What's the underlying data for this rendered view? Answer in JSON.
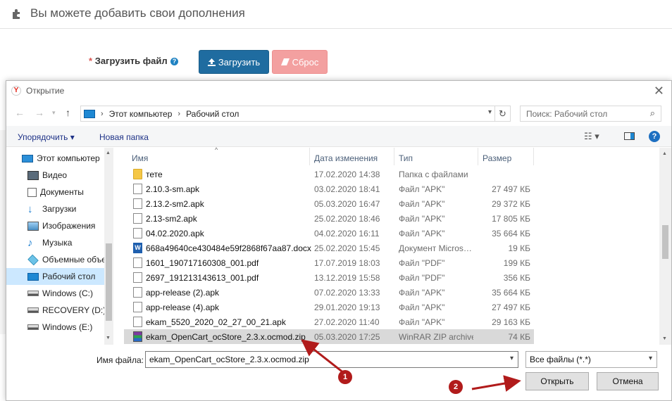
{
  "page": {
    "header_title": "Вы можете добавить свои дополнения",
    "required_star": "*",
    "upload_label": "Загрузить файл",
    "upload_button": "Загрузить",
    "reset_button": "Сброс",
    "help_glyph": "?"
  },
  "dialog": {
    "title": "Открытие",
    "address": {
      "crumbs": [
        "Этот компьютер",
        "Рабочий стол"
      ],
      "separator": "›"
    },
    "search_placeholder": "Поиск: Рабочий стол",
    "toolbar": {
      "organize": "Упорядочить ▾",
      "new_folder": "Новая папка",
      "help_glyph": "?"
    },
    "nav": [
      {
        "label": "Этот компьютер",
        "icon": "computer-icon"
      },
      {
        "label": "Видео",
        "icon": "video-icon"
      },
      {
        "label": "Документы",
        "icon": "documents-icon"
      },
      {
        "label": "Загрузки",
        "icon": "downloads-icon"
      },
      {
        "label": "Изображения",
        "icon": "images-icon"
      },
      {
        "label": "Музыка",
        "icon": "music-icon"
      },
      {
        "label": "Объемные объе",
        "icon": "3d-objects-icon"
      },
      {
        "label": "Рабочий стол",
        "icon": "desktop-icon",
        "selected": true
      },
      {
        "label": "Windows (C:)",
        "icon": "drive-icon"
      },
      {
        "label": "RECOVERY (D:)",
        "icon": "drive-icon"
      },
      {
        "label": "Windows (E:)",
        "icon": "drive-icon"
      }
    ],
    "columns": {
      "name": "Имя",
      "date": "Дата изменения",
      "type": "Тип",
      "size": "Размер"
    },
    "files": [
      {
        "name": "тете",
        "date": "17.02.2020 14:38",
        "type": "Папка с файлами",
        "size": "",
        "icon": "folder-icon"
      },
      {
        "name": "2.10.3-sm.apk",
        "date": "03.02.2020 18:41",
        "type": "Файл \"APK\"",
        "size": "27 497 КБ",
        "icon": "file-icon"
      },
      {
        "name": "2.13.2-sm2.apk",
        "date": "05.03.2020 16:47",
        "type": "Файл \"APK\"",
        "size": "29 372 КБ",
        "icon": "file-icon"
      },
      {
        "name": "2.13-sm2.apk",
        "date": "25.02.2020 18:46",
        "type": "Файл \"APK\"",
        "size": "17 805 КБ",
        "icon": "file-icon"
      },
      {
        "name": "04.02.2020.apk",
        "date": "04.02.2020 16:11",
        "type": "Файл \"APK\"",
        "size": "35 664 КБ",
        "icon": "file-icon"
      },
      {
        "name": "668a49640ce430484e59f2868f67aa87.docx",
        "date": "25.02.2020 15:45",
        "type": "Документ Micros…",
        "size": "19 КБ",
        "icon": "word-icon"
      },
      {
        "name": "1601_190717160308_001.pdf",
        "date": "17.07.2019 18:03",
        "type": "Файл \"PDF\"",
        "size": "199 КБ",
        "icon": "pdf-icon"
      },
      {
        "name": "2697_191213143613_001.pdf",
        "date": "13.12.2019 15:58",
        "type": "Файл \"PDF\"",
        "size": "356 КБ",
        "icon": "pdf-icon"
      },
      {
        "name": "app-release (2).apk",
        "date": "07.02.2020 13:33",
        "type": "Файл \"APK\"",
        "size": "35 664 КБ",
        "icon": "file-icon"
      },
      {
        "name": "app-release (4).apk",
        "date": "29.01.2020 19:13",
        "type": "Файл \"APK\"",
        "size": "27 497 КБ",
        "icon": "file-icon"
      },
      {
        "name": "ekam_5520_2020_02_27_00_21.apk",
        "date": "27.02.2020 11:40",
        "type": "Файл \"APK\"",
        "size": "29 163 КБ",
        "icon": "file-icon"
      },
      {
        "name": "ekam_OpenCart_ocStore_2.3.x.ocmod.zip",
        "date": "05.03.2020 17:25",
        "type": "WinRAR ZIP archive",
        "size": "74 КБ",
        "icon": "winrar-icon",
        "selected": true
      }
    ],
    "filename_label": "Имя файла:",
    "filename_value": "ekam_OpenCart_ocStore_2.3.x.ocmod.zip",
    "filter_value": "Все файлы (*.*)",
    "open_button": "Открыть",
    "cancel_button": "Отмена"
  },
  "annotations": {
    "badge1": "1",
    "badge2": "2",
    "color": "#b11b1b"
  }
}
